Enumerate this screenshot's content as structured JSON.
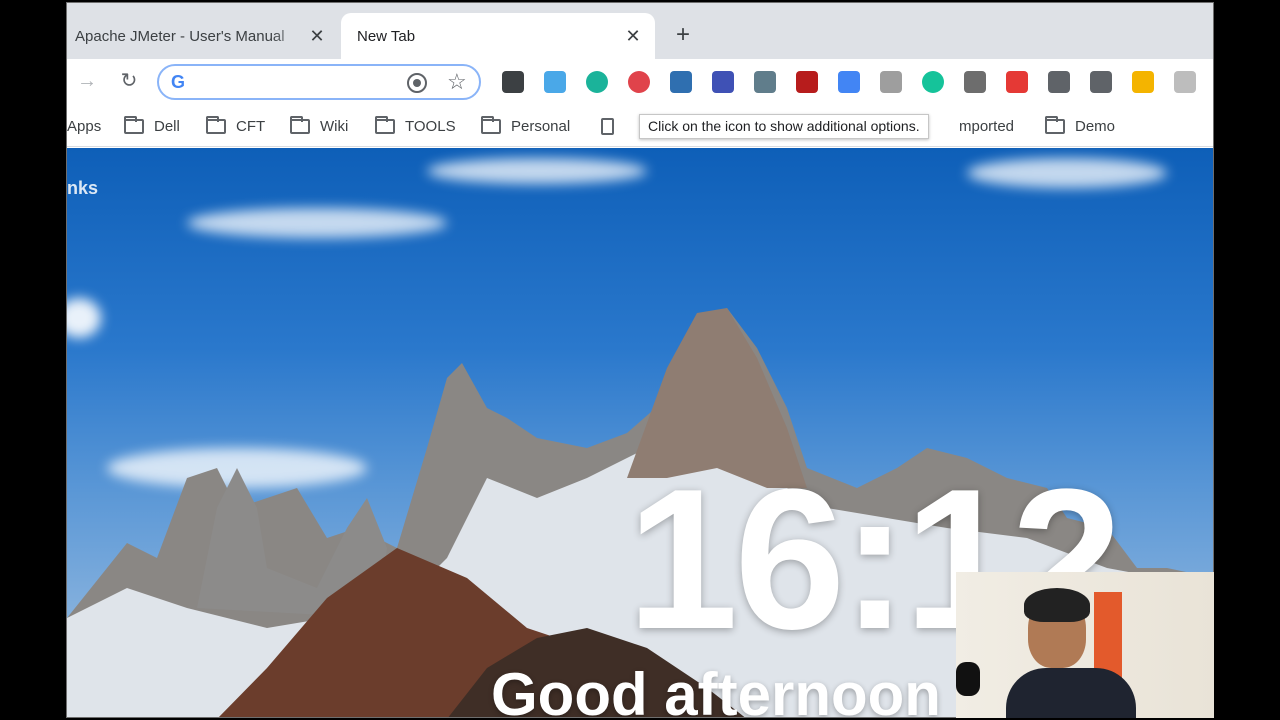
{
  "tabs": [
    {
      "title": "Apache JMeter - User's Manual",
      "active": false
    },
    {
      "title": "New Tab",
      "active": true
    }
  ],
  "icons": {
    "close": "✕",
    "new_tab": "+",
    "forward": "→",
    "reload": "↻",
    "google": "G",
    "star": "☆"
  },
  "omnibox": {
    "value": "",
    "placeholder": ""
  },
  "extensions": [
    {
      "name": "screen-capture-extension-icon",
      "color": "#3c4043"
    },
    {
      "name": "s-extension-icon",
      "color": "#4aa8e8"
    },
    {
      "name": "green-circle-extension-icon",
      "color": "#1bb39a"
    },
    {
      "name": "red-tag-extension-icon",
      "color": "#e0434b"
    },
    {
      "name": "printer-extension-icon",
      "color": "#2f6fb0"
    },
    {
      "name": "ruler-extension-icon",
      "color": "#3f51b5"
    },
    {
      "name": "magnifier-extension-icon",
      "color": "#607d8b"
    },
    {
      "name": "chess-pawn-extension-icon",
      "color": "#b71c1c"
    },
    {
      "name": "google-translate-extension-icon",
      "color": "#4285f4"
    },
    {
      "name": "tb-extension-icon",
      "color": "#9e9e9e"
    },
    {
      "name": "grammarly-extension-icon",
      "color": "#15c39a"
    },
    {
      "name": "diamond-extension-icon",
      "color": "#6d6d6d"
    },
    {
      "name": "percent-extension-icon",
      "color": "#e53935"
    },
    {
      "name": "function-extension-icon",
      "color": "#5f6368"
    },
    {
      "name": "eyedropper-extension-icon",
      "color": "#5f6368"
    },
    {
      "name": "calendar-extension-icon",
      "color": "#f4b400"
    },
    {
      "name": "notes-extension-icon",
      "color": "#bdbdbd"
    }
  ],
  "bookmarks": {
    "apps": "Apps",
    "dell": "Dell",
    "cft": "CFT",
    "wiki": "Wiki",
    "tools": "TOOLS",
    "personal": "Personal",
    "imported": "mported",
    "demo": "Demo"
  },
  "tooltip": "Click on the icon to show additional options.",
  "content": {
    "links_label": "nks",
    "clock": "16:12",
    "greeting": "Good afternoon"
  }
}
